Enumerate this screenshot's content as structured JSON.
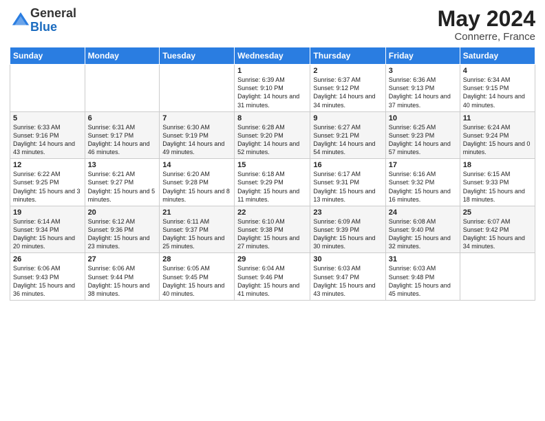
{
  "header": {
    "logo_general": "General",
    "logo_blue": "Blue",
    "month_title": "May 2024",
    "location": "Connerre, France"
  },
  "days_of_week": [
    "Sunday",
    "Monday",
    "Tuesday",
    "Wednesday",
    "Thursday",
    "Friday",
    "Saturday"
  ],
  "weeks": [
    [
      {
        "day": "",
        "info": ""
      },
      {
        "day": "",
        "info": ""
      },
      {
        "day": "",
        "info": ""
      },
      {
        "day": "1",
        "info": "Sunrise: 6:39 AM\nSunset: 9:10 PM\nDaylight: 14 hours and 31 minutes."
      },
      {
        "day": "2",
        "info": "Sunrise: 6:37 AM\nSunset: 9:12 PM\nDaylight: 14 hours and 34 minutes."
      },
      {
        "day": "3",
        "info": "Sunrise: 6:36 AM\nSunset: 9:13 PM\nDaylight: 14 hours and 37 minutes."
      },
      {
        "day": "4",
        "info": "Sunrise: 6:34 AM\nSunset: 9:15 PM\nDaylight: 14 hours and 40 minutes."
      }
    ],
    [
      {
        "day": "5",
        "info": "Sunrise: 6:33 AM\nSunset: 9:16 PM\nDaylight: 14 hours and 43 minutes."
      },
      {
        "day": "6",
        "info": "Sunrise: 6:31 AM\nSunset: 9:17 PM\nDaylight: 14 hours and 46 minutes."
      },
      {
        "day": "7",
        "info": "Sunrise: 6:30 AM\nSunset: 9:19 PM\nDaylight: 14 hours and 49 minutes."
      },
      {
        "day": "8",
        "info": "Sunrise: 6:28 AM\nSunset: 9:20 PM\nDaylight: 14 hours and 52 minutes."
      },
      {
        "day": "9",
        "info": "Sunrise: 6:27 AM\nSunset: 9:21 PM\nDaylight: 14 hours and 54 minutes."
      },
      {
        "day": "10",
        "info": "Sunrise: 6:25 AM\nSunset: 9:23 PM\nDaylight: 14 hours and 57 minutes."
      },
      {
        "day": "11",
        "info": "Sunrise: 6:24 AM\nSunset: 9:24 PM\nDaylight: 15 hours and 0 minutes."
      }
    ],
    [
      {
        "day": "12",
        "info": "Sunrise: 6:22 AM\nSunset: 9:25 PM\nDaylight: 15 hours and 3 minutes."
      },
      {
        "day": "13",
        "info": "Sunrise: 6:21 AM\nSunset: 9:27 PM\nDaylight: 15 hours and 5 minutes."
      },
      {
        "day": "14",
        "info": "Sunrise: 6:20 AM\nSunset: 9:28 PM\nDaylight: 15 hours and 8 minutes."
      },
      {
        "day": "15",
        "info": "Sunrise: 6:18 AM\nSunset: 9:29 PM\nDaylight: 15 hours and 11 minutes."
      },
      {
        "day": "16",
        "info": "Sunrise: 6:17 AM\nSunset: 9:31 PM\nDaylight: 15 hours and 13 minutes."
      },
      {
        "day": "17",
        "info": "Sunrise: 6:16 AM\nSunset: 9:32 PM\nDaylight: 15 hours and 16 minutes."
      },
      {
        "day": "18",
        "info": "Sunrise: 6:15 AM\nSunset: 9:33 PM\nDaylight: 15 hours and 18 minutes."
      }
    ],
    [
      {
        "day": "19",
        "info": "Sunrise: 6:14 AM\nSunset: 9:34 PM\nDaylight: 15 hours and 20 minutes."
      },
      {
        "day": "20",
        "info": "Sunrise: 6:12 AM\nSunset: 9:36 PM\nDaylight: 15 hours and 23 minutes."
      },
      {
        "day": "21",
        "info": "Sunrise: 6:11 AM\nSunset: 9:37 PM\nDaylight: 15 hours and 25 minutes."
      },
      {
        "day": "22",
        "info": "Sunrise: 6:10 AM\nSunset: 9:38 PM\nDaylight: 15 hours and 27 minutes."
      },
      {
        "day": "23",
        "info": "Sunrise: 6:09 AM\nSunset: 9:39 PM\nDaylight: 15 hours and 30 minutes."
      },
      {
        "day": "24",
        "info": "Sunrise: 6:08 AM\nSunset: 9:40 PM\nDaylight: 15 hours and 32 minutes."
      },
      {
        "day": "25",
        "info": "Sunrise: 6:07 AM\nSunset: 9:42 PM\nDaylight: 15 hours and 34 minutes."
      }
    ],
    [
      {
        "day": "26",
        "info": "Sunrise: 6:06 AM\nSunset: 9:43 PM\nDaylight: 15 hours and 36 minutes."
      },
      {
        "day": "27",
        "info": "Sunrise: 6:06 AM\nSunset: 9:44 PM\nDaylight: 15 hours and 38 minutes."
      },
      {
        "day": "28",
        "info": "Sunrise: 6:05 AM\nSunset: 9:45 PM\nDaylight: 15 hours and 40 minutes."
      },
      {
        "day": "29",
        "info": "Sunrise: 6:04 AM\nSunset: 9:46 PM\nDaylight: 15 hours and 41 minutes."
      },
      {
        "day": "30",
        "info": "Sunrise: 6:03 AM\nSunset: 9:47 PM\nDaylight: 15 hours and 43 minutes."
      },
      {
        "day": "31",
        "info": "Sunrise: 6:03 AM\nSunset: 9:48 PM\nDaylight: 15 hours and 45 minutes."
      },
      {
        "day": "",
        "info": ""
      }
    ]
  ]
}
